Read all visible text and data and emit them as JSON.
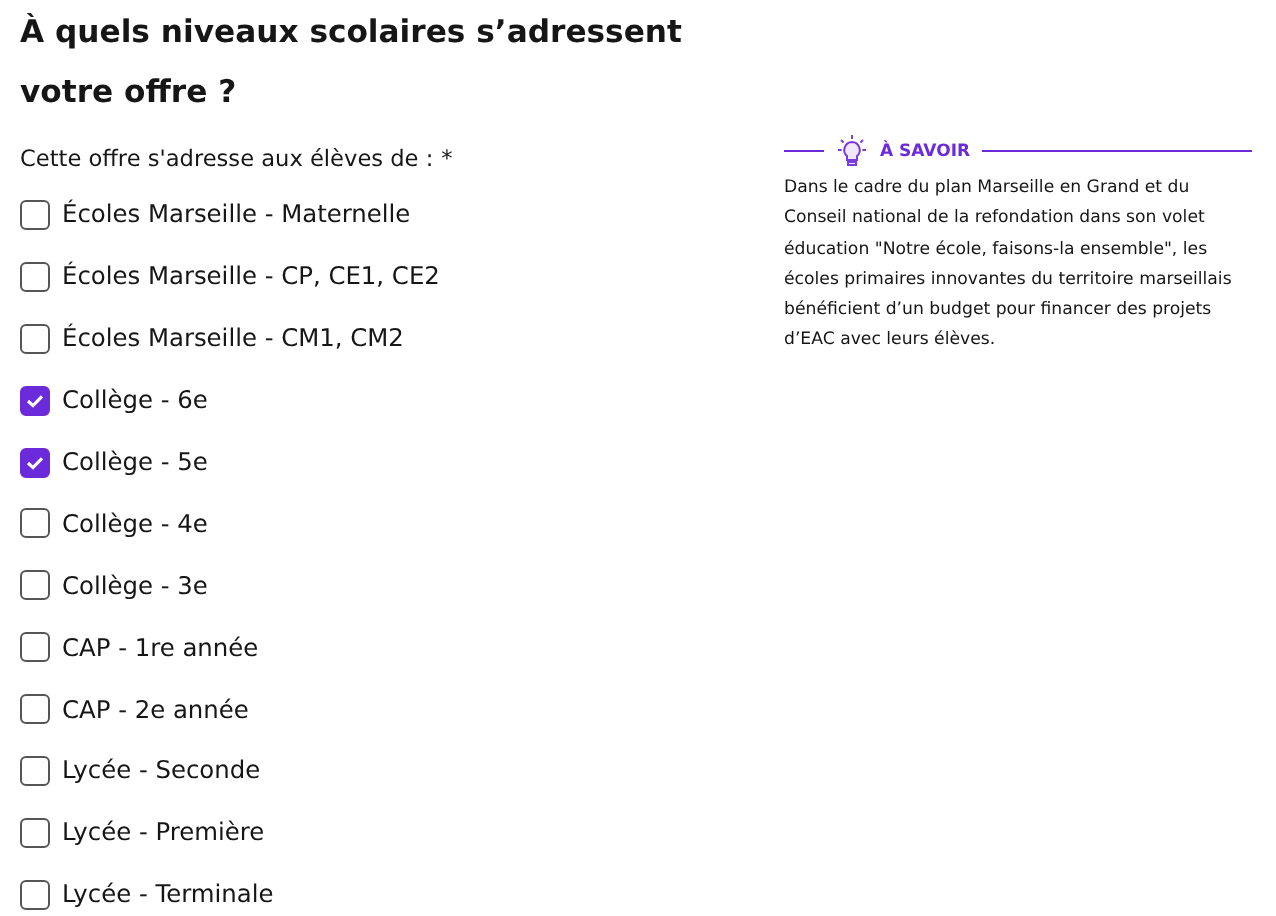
{
  "title": "À quels niveaux scolaires s’adressent votre offre ?",
  "question": {
    "label": "Cette offre s'adresse aux élèves de :",
    "required_mark": "*"
  },
  "options": [
    {
      "label": "Écoles Marseille - Maternelle",
      "checked": false
    },
    {
      "label": "Écoles Marseille - CP, CE1, CE2",
      "checked": false
    },
    {
      "label": "Écoles Marseille - CM1, CM2",
      "checked": false
    },
    {
      "label": "Collège - 6e",
      "checked": true
    },
    {
      "label": "Collège - 5e",
      "checked": true
    },
    {
      "label": "Collège - 4e",
      "checked": false
    },
    {
      "label": "Collège - 3e",
      "checked": false
    },
    {
      "label": "CAP - 1re année",
      "checked": false
    },
    {
      "label": "CAP - 2e année",
      "checked": false
    },
    {
      "label": "Lycée - Seconde",
      "checked": false
    },
    {
      "label": "Lycée - Première",
      "checked": false
    },
    {
      "label": "Lycée - Terminale",
      "checked": false
    }
  ],
  "info": {
    "title": "À SAVOIR",
    "text": "Dans le cadre du plan Marseille en Grand et du Conseil national de la refondation dans son volet éducation \"Notre école, faisons-la ensemble\", les écoles primaires innovantes du territoire marseillais bénéficient d’un budget pour financer des projets d’EAC avec leurs élèves."
  }
}
